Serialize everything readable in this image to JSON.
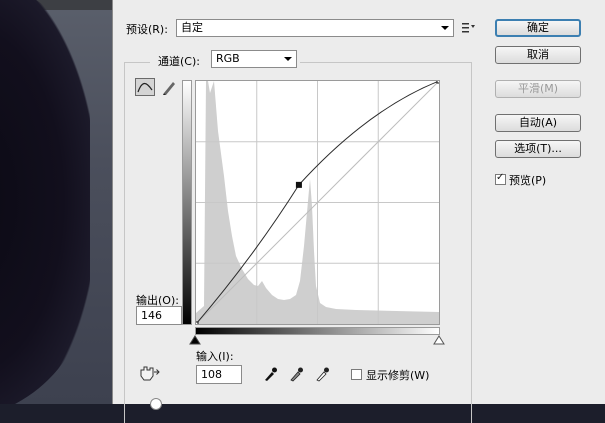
{
  "preset": {
    "label": "预设(R):",
    "value": "自定"
  },
  "channel": {
    "label": "通道(C):",
    "value": "RGB"
  },
  "buttons": {
    "ok": "确定",
    "cancel": "取消",
    "smooth": "平滑(M)",
    "auto": "自动(A)",
    "options": "选项(T)..."
  },
  "preview": {
    "label": "预览(P)",
    "checked": true
  },
  "output": {
    "label": "输出(O):",
    "value": "146"
  },
  "input": {
    "label": "输入(I):",
    "value": "108"
  },
  "show_clipping": {
    "label": "显示修剪(W)",
    "checked": false
  },
  "icons": {
    "curve_tool": "curve-tool-icon",
    "pencil_tool": "pencil-icon",
    "preset_menu": "preset-options-icon",
    "hand_adjust": "targeted-adjustment-icon",
    "eyedropper_black": "black-eyedropper-icon",
    "eyedropper_gray": "gray-eyedropper-icon",
    "eyedropper_white": "white-eyedropper-icon"
  },
  "colors": {
    "default_button_border": "#3c7fb1",
    "dialog_bg": "#ececec",
    "histogram": "#cfcfcf"
  },
  "curve": {
    "points": [
      [
        0,
        0
      ],
      [
        108,
        146
      ],
      [
        255,
        255
      ]
    ],
    "selected_point": [
      108,
      146
    ]
  }
}
